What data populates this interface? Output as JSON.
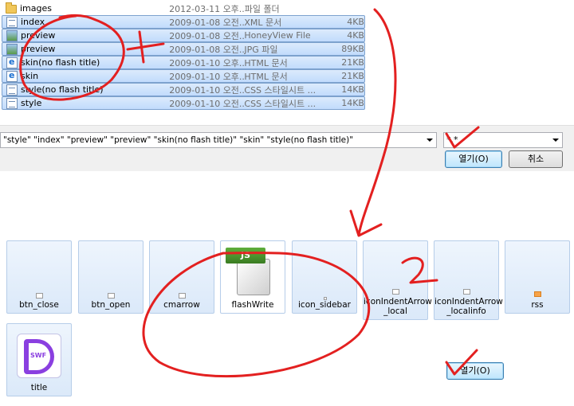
{
  "file_list": {
    "rows": [
      {
        "name": "images",
        "date": "2012-03-11 오후...",
        "type": "파일 폴더",
        "size": "",
        "icon": "folder-icon",
        "selected": false
      },
      {
        "name": "index",
        "date": "2009-01-08 오전...",
        "type": "XML 문서",
        "size": "4KB",
        "icon": "xml-document-icon",
        "selected": true
      },
      {
        "name": "preview",
        "date": "2009-01-08 오전...",
        "type": "HoneyView File",
        "size": "4KB",
        "icon": "image-file-icon",
        "selected": true
      },
      {
        "name": "preview",
        "date": "2009-01-08 오전...",
        "type": "JPG 파일",
        "size": "89KB",
        "icon": "image-file-icon",
        "selected": true
      },
      {
        "name": "skin(no flash title)",
        "date": "2009-01-10 오후...",
        "type": "HTML 문서",
        "size": "21KB",
        "icon": "html-document-icon",
        "selected": true
      },
      {
        "name": "skin",
        "date": "2009-01-10 오후...",
        "type": "HTML 문서",
        "size": "21KB",
        "icon": "html-document-icon",
        "selected": true
      },
      {
        "name": "style(no flash title)",
        "date": "2009-01-10 오전...",
        "type": "CSS 스타일시트 ...",
        "size": "14KB",
        "icon": "css-document-icon",
        "selected": true
      },
      {
        "name": "style",
        "date": "2009-01-10 오전...",
        "type": "CSS 스타일시트 ...",
        "size": "14KB",
        "icon": "css-document-icon",
        "selected": true
      }
    ]
  },
  "dialog": {
    "filename_value": "\"style\" \"index\" \"preview\" \"preview\" \"skin(no flash title)\" \"skin\" \"style(no flash title)\"",
    "filter_value": "*.*",
    "open_label": "열기(O)",
    "cancel_label": "취소"
  },
  "thumbnails": {
    "items": [
      {
        "label": "btn_close",
        "icon": "close-thumbnail-icon"
      },
      {
        "label": "btn_open",
        "icon": "open-thumbnail-icon"
      },
      {
        "label": "cmarrow",
        "icon": "arrow-thumbnail-icon"
      },
      {
        "label": "flashWrite",
        "icon": "javascript-file-icon",
        "badge": "JS"
      },
      {
        "label": "icon_sidebar",
        "icon": "sidebar-thumbnail-icon"
      },
      {
        "label": "iconIndentArrow\n_local",
        "icon": "indent-arrow-thumbnail-icon"
      },
      {
        "label": "iconIndentArrow\n_localinfo",
        "icon": "indent-arrow-thumbnail-icon"
      },
      {
        "label": "rss",
        "icon": "rss-thumbnail-icon"
      },
      {
        "label": "title",
        "icon": "swf-file-icon",
        "badge": "SWF"
      }
    ],
    "open_label": "열기(O)"
  },
  "colors": {
    "selection": "#c1dbfc",
    "annotation": "#e32020",
    "js_badge": "#4a9a2e",
    "swf": "#8a3fe0"
  }
}
